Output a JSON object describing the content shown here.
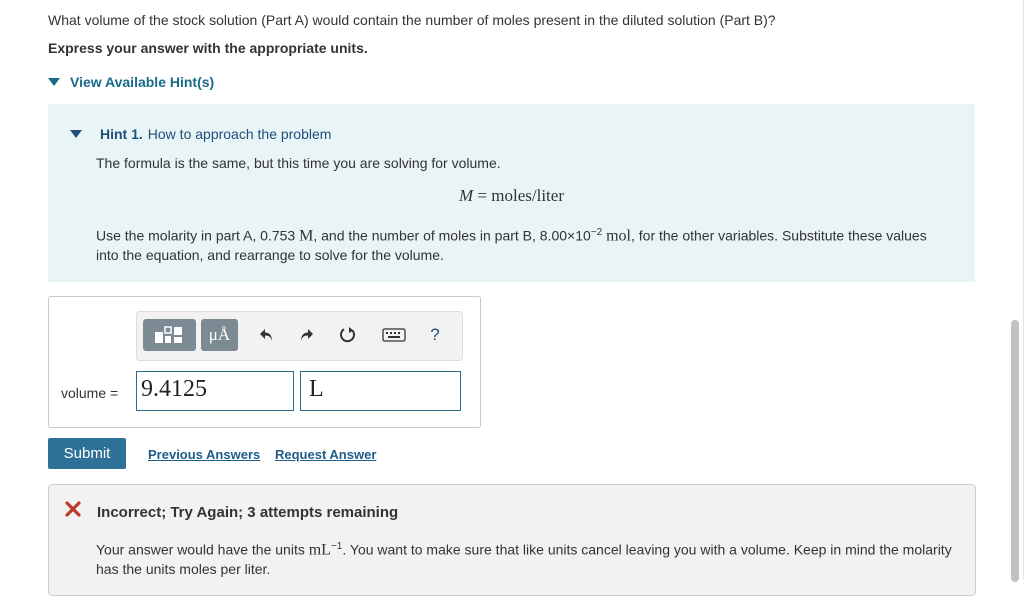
{
  "question": {
    "text": "What volume of the stock solution (Part A) would contain the number of moles present in the diluted solution (Part B)?",
    "instruction": "Express your answer with the appropriate units."
  },
  "hints": {
    "toggle_label": "View Available Hint(s)",
    "hint1": {
      "number": "Hint 1.",
      "title": "How to approach the problem",
      "para1": "The formula is the same, but this time you are solving for volume.",
      "formula_var": "M",
      "formula_eq": "= moles/liter",
      "p2_a": "Use the molarity in part A, 0.753 ",
      "p2_unitM": "M",
      "p2_b": ", and the number of moles in part B, 8.00×10",
      "p2_exp": "−2",
      "p2_unitmol": "mol",
      "p2_c": ", for the other variables. Substitute these values into the equation, and rearrange to solve for the volume."
    }
  },
  "answer": {
    "label": "volume =",
    "value": "9.4125",
    "unit": "L",
    "toolbar": {
      "templates_icon": "templates-icon",
      "units_label": "μÅ",
      "undo_icon": "undo-icon",
      "redo_icon": "redo-icon",
      "reset_icon": "reset-icon",
      "keyboard_icon": "keyboard-icon",
      "help_label": "?"
    }
  },
  "actions": {
    "submit_label": "Submit",
    "previous_answers_label": "Previous Answers",
    "request_answer_label": "Request Answer"
  },
  "feedback": {
    "title": "Incorrect; Try Again; 3 attempts remaining",
    "body_a": "Your answer would have the units ",
    "body_unit": "mL",
    "body_exp": "−1",
    "body_b": ". You want to make sure that like units cancel leaving you with a volume. Keep in mind the molarity has the units moles per liter."
  },
  "colors": {
    "accent": "#2d7196",
    "link": "#1e5d8a",
    "hint_bg": "#e9f4f7",
    "error": "#c0392b"
  }
}
